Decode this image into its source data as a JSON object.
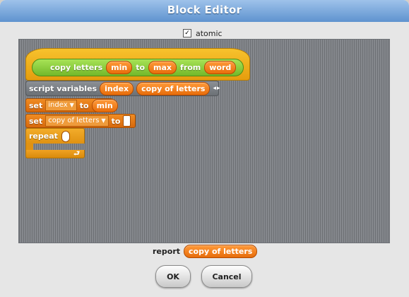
{
  "dialog": {
    "title": "Block Editor",
    "atomic_label": "atomic",
    "atomic_checked": "✓"
  },
  "prototype": {
    "text_copy_letters": "copy letters",
    "param_min": "min",
    "text_to": "to",
    "param_max": "max",
    "text_from": "from",
    "param_word": "word"
  },
  "script": {
    "script_variables_label": "script variables",
    "var_index": "index",
    "var_copy_of_letters": "copy of letters",
    "arrow_left": "◂",
    "arrow_right": "▸",
    "set1": {
      "set_label": "set",
      "var": "index",
      "to_label": "to",
      "value": "min"
    },
    "set2": {
      "set_label": "set",
      "var": "copy of letters",
      "to_label": "to"
    },
    "repeat_label": "repeat",
    "loop_arrow": "⮐"
  },
  "report": {
    "label": "report",
    "value": "copy of letters"
  },
  "buttons": {
    "ok": "OK",
    "cancel": "Cancel"
  }
}
